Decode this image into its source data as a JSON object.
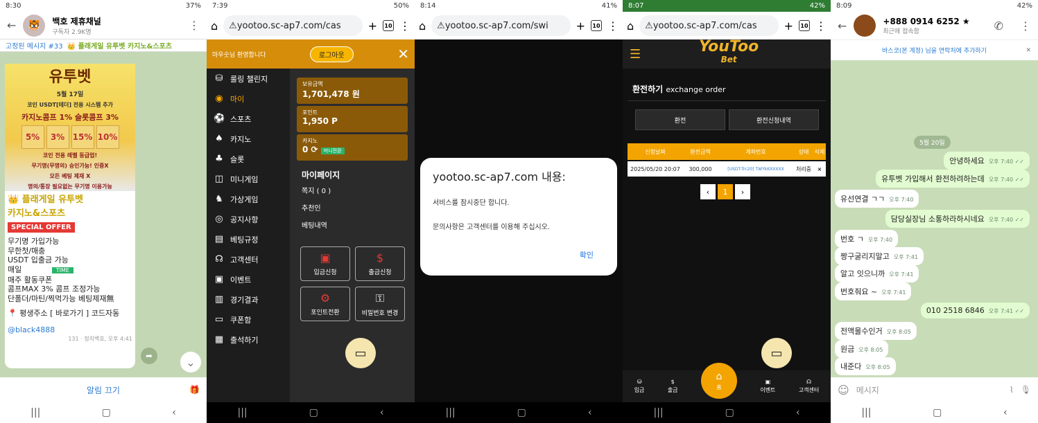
{
  "p1": {
    "time": "8:30",
    "battery": "37%",
    "channel": "백호 제휴채널",
    "subs": "구독자 2.9K명",
    "pinned": "고정된 메시지 #33",
    "pin_text": "👑 플래게일 유투벳 카지노&스포츠",
    "ban_title": "유투벳",
    "ban_date": "5월 17일",
    "ban_l1": "코인 USDT[테더] 전용 시스템 추가",
    "ban_l2": "카지노콤프 1% 슬롯콤프 3%",
    "ban_boxes": [
      "5%",
      "3%",
      "15%",
      "10%"
    ],
    "ban_l3": "코인 전용 레벨 등급업!",
    "ban_l4": "무기명(무명의) 승인가능! 인증X",
    "ban_l5": "모든 베팅 제재 X",
    "ban_l6": "명의/통장 필요없는 무기명 이용가능",
    "lines": [
      "👑 플래게일 유투벳",
      "카지노&스포츠",
      "SPECIAL OFFER",
      "무기명 가입가능",
      "무한첫/매충",
      "USDT 입출금 가능",
      "매일",
      "매주 활동쿠폰",
      "콤프MAX 3% 콤프 조정가능",
      "단폴더/마틴/찍먹가능 베팅제재無",
      "📍 평생주소 [ 바로가기 ] 코드자동",
      "@black4888"
    ],
    "time_badge": "TIME",
    "views": "131",
    "meta": "정지백호, 오후 4:41",
    "mute": "알림 끄기"
  },
  "p2": {
    "time": "7:39",
    "battery": "50%",
    "url": "yootoo.sc-ap7.com/cas",
    "tabs": "10",
    "welcome": "마우숫님 환영합니다",
    "logout": "로그아웃",
    "menu": [
      "룰링 챌린지",
      "마이",
      "스포츠",
      "카지노",
      "슬롯",
      "미니게임",
      "가상게임",
      "공지사항",
      "베팅규정",
      "고객센터",
      "이벤트",
      "경기결과",
      "쿠폰함",
      "출석하기"
    ],
    "b1l": "보유금액",
    "b1v": "1,701,478 원",
    "b2l": "포인트",
    "b2v": "1,950 P",
    "b3l": "카지노",
    "b3v": "0",
    "b3btn": "머니전환",
    "mypage": "마이페이지",
    "mp": [
      "쪽지 ( 0 )",
      "추천인",
      "베팅내역"
    ],
    "sq": [
      "입금신청",
      "출금신청",
      "포인트전환",
      "비밀번호 변경"
    ]
  },
  "p3": {
    "time": "8:14",
    "battery": "41%",
    "url": "yootoo.sc-ap7.com/swi",
    "tabs": "10",
    "title": "yootoo.sc-ap7.com 내용:",
    "m1": "서비스를 잠시중단 합니다.",
    "m2": "문의사항은 고객센터를 이용해 주십시오.",
    "ok": "확인"
  },
  "p4": {
    "time": "8:07",
    "battery": "42%",
    "url": "yootoo.sc-ap7.com/cas",
    "tabs": "10",
    "logo1": "YouToo",
    "logo2": "Bet",
    "heading": "환전하기",
    "heading_en": "exchange order",
    "btn1": "환전",
    "btn2": "환전신청내역",
    "cols": [
      "신청날짜",
      "환전금액",
      "계좌번호",
      "상태",
      "삭제"
    ],
    "row": [
      "2025/05/20 20:07",
      "300,000",
      "[USDT-Trc20] TWYkKXXXXX",
      "처리중",
      "×"
    ],
    "page": "1",
    "nav": [
      "입금",
      "출금",
      "홈",
      "이벤트",
      "고객센터"
    ]
  },
  "p5": {
    "time": "8:09",
    "battery": "42%",
    "name": "+888 0914 6252 ★",
    "status": "최근에 접속함",
    "add": "바스코(본 계정) 님을 연락처에 추가하기",
    "date": "5월 20일",
    "msgs": [
      {
        "t": "안녕하세요",
        "tm": "오후 7:40 ✓✓"
      },
      {
        "t": "유투벳 가입해서 환전하려하는데",
        "tm": "오후 7:40 ✓✓"
      },
      {
        "t": "유선연결 ㄱㄱ",
        "tm": "오후 7:40"
      },
      {
        "t": "담당실장님 소통하라하시네요",
        "tm": "오후 7:40 ✓✓"
      },
      {
        "t": "번호 ㄱ",
        "tm": "오후 7:40"
      },
      {
        "t": "짱구굴리지말고",
        "tm": "오후 7:41"
      },
      {
        "t": "알고 잇으니까",
        "tm": "오후 7:41"
      },
      {
        "t": "번호줘요 ~",
        "tm": "오후 7:41"
      },
      {
        "t": "010 2518 6846",
        "tm": "오후 7:41 ✓✓"
      },
      {
        "t": "전액몰수인거",
        "tm": "오후 8:05"
      },
      {
        "t": "원금",
        "tm": "오후 8:05"
      },
      {
        "t": "내준다",
        "tm": "오후 8:05"
      }
    ],
    "input": "메시지"
  }
}
